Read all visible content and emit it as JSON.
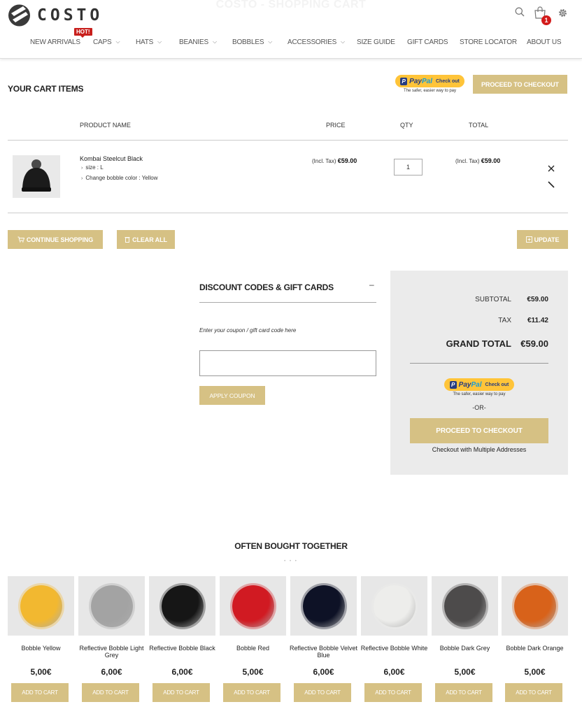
{
  "header": {
    "logo_text": "COSTO",
    "page_title": "COSTO - SHOPPING CART",
    "cart_count": "1",
    "hot_badge": "HOT!",
    "nav": [
      {
        "label": "NEW ARRIVALS",
        "chevron": false
      },
      {
        "label": "CAPS",
        "chevron": true
      },
      {
        "label": "HATS",
        "chevron": true
      },
      {
        "label": "BEANIES",
        "chevron": true
      },
      {
        "label": "BOBBLES",
        "chevron": true
      },
      {
        "label": "ACCESSORIES",
        "chevron": true
      },
      {
        "label": "SIZE GUIDE",
        "chevron": false
      },
      {
        "label": "GIFT CARDS",
        "chevron": false
      },
      {
        "label": "STORE LOCATOR",
        "chevron": false
      },
      {
        "label": "ABOUT US",
        "chevron": false
      }
    ]
  },
  "cart": {
    "title": "YOUR CART ITEMS",
    "paypal_logo_1": "Pay",
    "paypal_logo_2": "Pal",
    "paypal_check": "Check out",
    "paypal_caption": "The safer, easier way to pay",
    "checkout_label": "PROCEED TO CHECKOUT",
    "columns": {
      "product": "PRODUCT NAME",
      "price": "PRICE",
      "qty": "QTY",
      "total": "TOTAL"
    },
    "item": {
      "name": "Kombai Steelcut Black",
      "option_1": "size : L",
      "option_2": "Change bobble color : Yellow",
      "price_prefix": "(Incl. Tax)",
      "price": "€59.00",
      "qty": "1",
      "total_prefix": "(Incl. Tax)",
      "total": "€59.00"
    },
    "continue_label": "CONTINUE SHOPPING",
    "clear_label": "CLEAR ALL",
    "update_label": "UPDATE"
  },
  "discount": {
    "title": "DISCOUNT CODES & GIFT CARDS",
    "toggle": "–",
    "hint": "Enter your coupon / gift card code here",
    "input_value": "",
    "apply_label": "APPLY COUPON"
  },
  "summary": {
    "subtotal_label": "SUBTOTAL",
    "subtotal": "€59.00",
    "tax_label": "TAX",
    "tax": "€11.42",
    "grand_label": "GRAND TOTAL",
    "grand": "€59.00",
    "or_label": "-OR-",
    "checkout_label": "PROCEED TO CHECKOUT",
    "multi_label": "Checkout with Multiple Addresses"
  },
  "related": {
    "title": "OFTEN BOUGHT TOGETHER",
    "add_label": "ADD TO CART",
    "products": [
      {
        "name": "Bobble Yellow",
        "price": "5,00€",
        "color": "#f2b830"
      },
      {
        "name": "Reflective Bobble Light Grey",
        "price": "6,00€",
        "color": "#a3a3a3"
      },
      {
        "name": "Reflective Bobble Black",
        "price": "6,00€",
        "color": "#161616"
      },
      {
        "name": "Bobble Red",
        "price": "5,00€",
        "color": "#d11a22"
      },
      {
        "name": "Reflective Bobble Velvet Blue",
        "price": "6,00€",
        "color": "#0e1226"
      },
      {
        "name": "Reflective Bobble White",
        "price": "6,00€",
        "color": "#ededeb"
      },
      {
        "name": "Bobble Dark Grey",
        "price": "5,00€",
        "color": "#4d4b4b"
      },
      {
        "name": "Bobble Dark Orange",
        "price": "5,00€",
        "color": "#d8621a"
      }
    ]
  },
  "colors": {
    "accent_gold": "#d6c184",
    "badge_red": "#d31c1c",
    "paypal_yellow": "#ffc439"
  }
}
